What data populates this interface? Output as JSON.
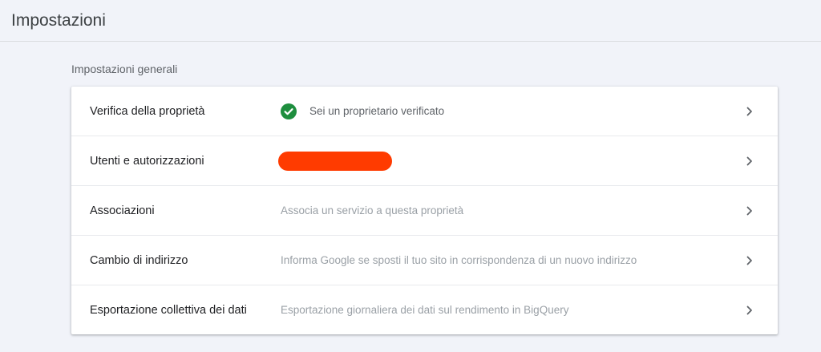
{
  "header": {
    "title": "Impostazioni"
  },
  "section": {
    "heading": "Impostazioni generali"
  },
  "colors": {
    "check": "#1e8e3e",
    "redaction": "#ff3b00"
  },
  "rows": [
    {
      "label": "Verifica della proprietà",
      "value": "Sei un proprietario verificato"
    },
    {
      "label": "Utenti e autorizzazioni",
      "value": ""
    },
    {
      "label": "Associazioni",
      "value": "Associa un servizio a questa proprietà"
    },
    {
      "label": "Cambio di indirizzo",
      "value": "Informa Google se sposti il tuo sito in corrispondenza di un nuovo indirizzo"
    },
    {
      "label": "Esportazione collettiva dei dati",
      "value": "Esportazione giornaliera dei dati sul rendimento in BigQuery"
    }
  ]
}
